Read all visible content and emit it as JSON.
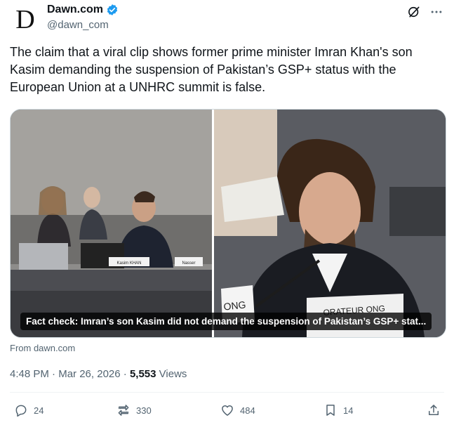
{
  "author": {
    "avatar_letter": "D",
    "display_name": "Dawn.com",
    "handle": "@dawn_com",
    "verified_color": "#1d9bf0"
  },
  "top_icons": [
    "grok-icon",
    "more-icon"
  ],
  "tweet": {
    "text": "The claim that a viral clip shows former prime minister Imran Khan's son Kasim demanding the suspension of Pakistan’s GSP+ status with the European Union at a UNHRC summit is false."
  },
  "card": {
    "caption": "Fact check: Imran’s son Kasim did not demand the suspension of Pakistan’s GSP+ stat...",
    "nameplate_left": "Kasim KHAN",
    "nameplate_left_2": "Nasser",
    "nameplate_right": "ONG",
    "nameplate_right_2": "ORATEUR ONG"
  },
  "from_link": "From dawn.com",
  "meta": {
    "time": "4:48 PM",
    "separator": "·",
    "date": "Mar 26, 2026",
    "views_count": "5,553",
    "views_label": "Views"
  },
  "actions": {
    "replies": "24",
    "reposts": "330",
    "likes": "484",
    "bookmarks": "14"
  }
}
